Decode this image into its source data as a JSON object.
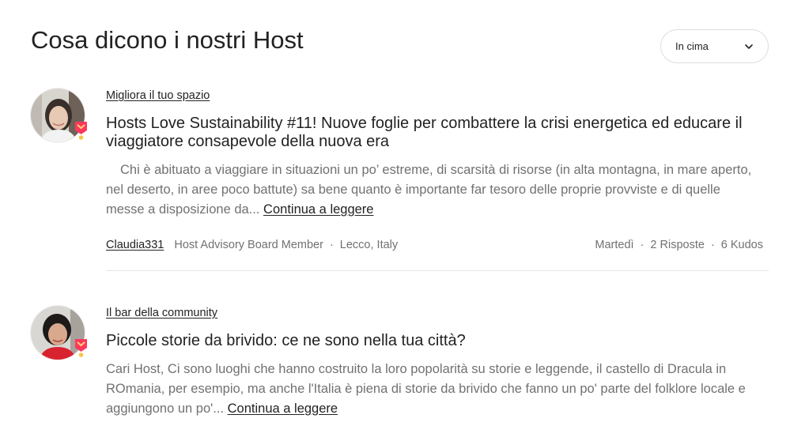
{
  "header": {
    "title": "Cosa dicono i nostri Host",
    "sort": {
      "selected": "In cima",
      "icon": "chevron-down-icon"
    }
  },
  "posts": [
    {
      "category": "Migliora il tuo spazio",
      "title": "Hosts Love Sustainability #11! Nuove foglie per combattere la crisi energetica ed educare il viaggiatore consapevole della nuova era",
      "excerpt": "Chi è abituato a viaggiare in situazioni un po’ estreme, di scarsità di risorse (in alta montagna, in mare aperto, nel deserto, in aree poco battute) sa bene quanto è importante far tesoro delle proprie provviste e di quelle messe a disposizione da...",
      "read_more": "Continua a leggere",
      "author": "Claudia331",
      "role": "Host Advisory Board Member",
      "location": "Lecco, Italy",
      "date": "Martedì",
      "replies": "2 Risposte",
      "kudos": "6 Kudos"
    },
    {
      "category": "Il bar della community",
      "title": "Piccole storie da brivido: ce ne sono nella tua città?",
      "excerpt": "Cari Host, Ci sono luoghi che hanno costruito la loro popolarità su storie e leggende, il castello di Dracula in ROmania, per esempio, ma anche l'Italia è piena di storie da brivido che fanno un po' parte del folklore locale e aggiungono un po'...",
      "read_more": "Continua a leggere"
    }
  ],
  "colors": {
    "text": "#222222",
    "muted": "#717171",
    "divider": "#e5e5e5",
    "badge": "#ff385c"
  }
}
